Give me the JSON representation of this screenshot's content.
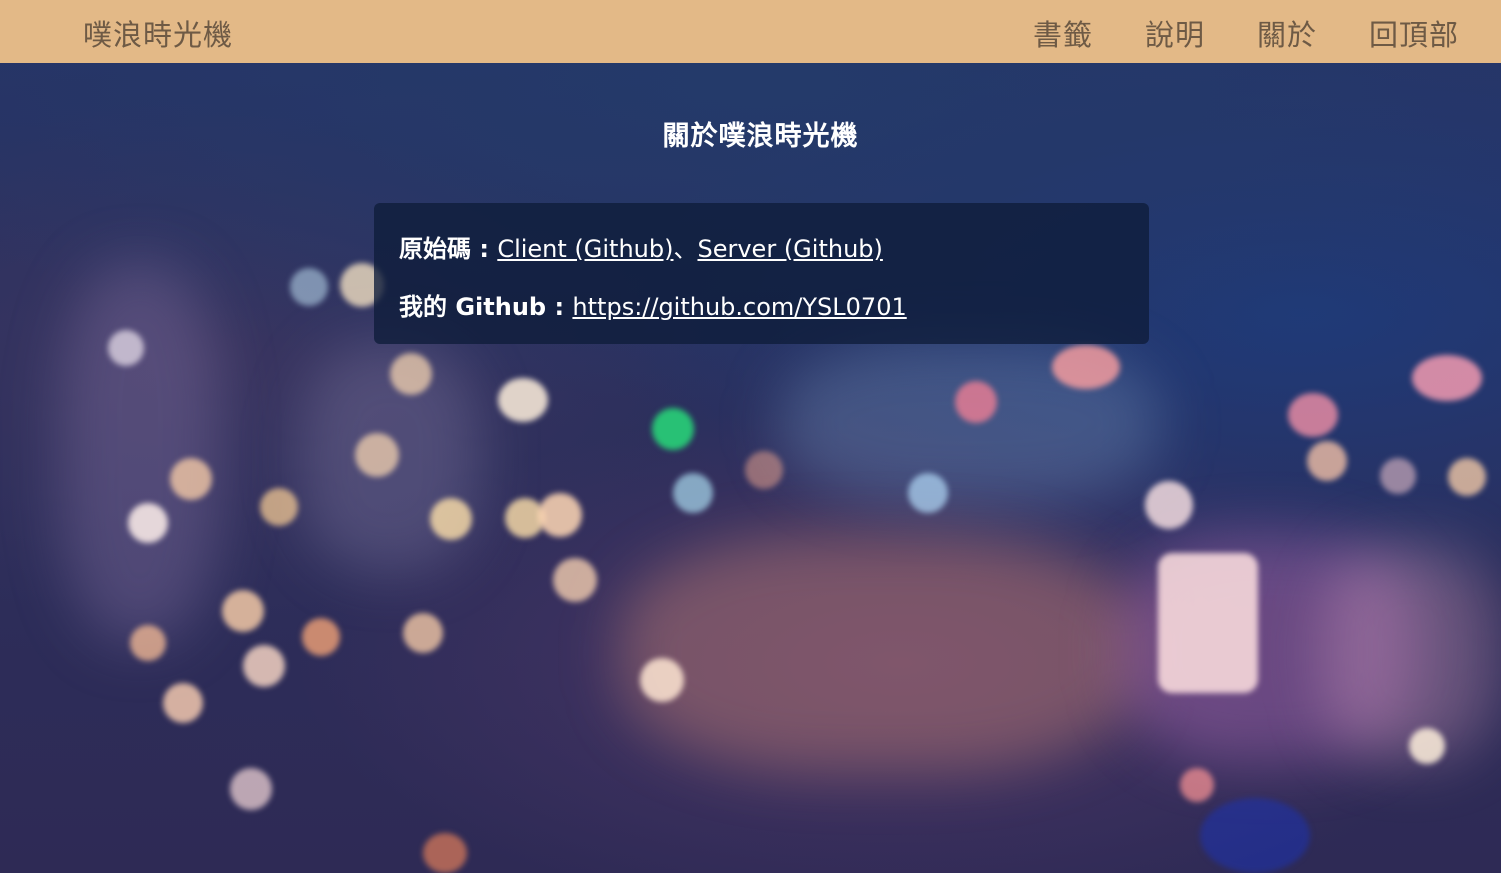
{
  "navbar": {
    "brand": "噗浪時光機",
    "links": [
      "書籤",
      "說明",
      "關於",
      "回頂部"
    ]
  },
  "main": {
    "heading": "關於噗浪時光機",
    "source_label": "原始碼 : ",
    "client_link": "Client (Github)",
    "separator": "、",
    "server_link": "Server (Github)",
    "github_label": "我的 Github : ",
    "github_url": "https://github.com/YSL0701"
  },
  "colors": {
    "navbar_bg": "#e3b987",
    "navbar_text": "#6e5a45",
    "card_bg": "#0e1c3a",
    "text": "#ffffff"
  }
}
